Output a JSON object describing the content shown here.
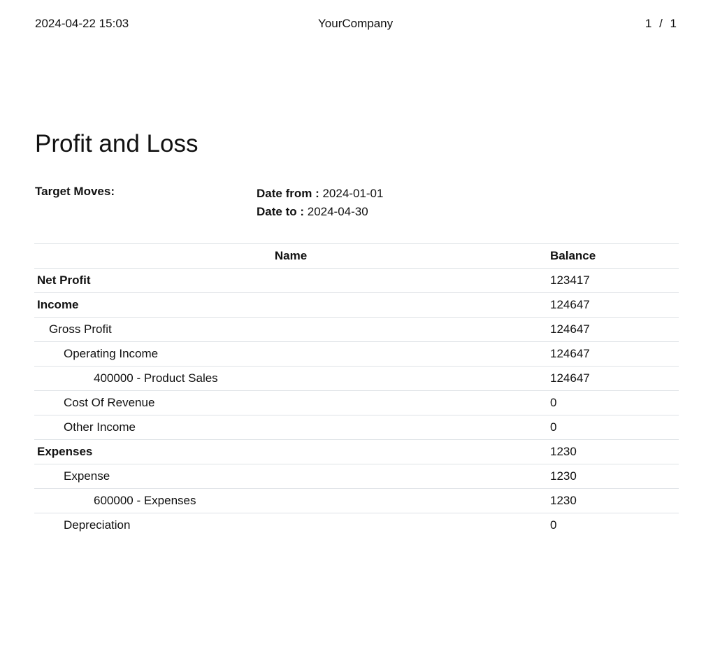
{
  "header": {
    "timestamp": "2024-04-22 15:03",
    "company": "YourCompany",
    "page_indicator": "1 / 1"
  },
  "report": {
    "title": "Profit and Loss",
    "target_moves_label": "Target Moves:",
    "date_from_label": "Date from :",
    "date_from_value": "2024-01-01",
    "date_to_label": "Date to :",
    "date_to_value": "2024-04-30"
  },
  "table": {
    "columns": [
      "Name",
      "Balance"
    ],
    "rows": [
      {
        "name": "Net Profit",
        "balance": "123417",
        "level": 1
      },
      {
        "name": "Income",
        "balance": "124647",
        "level": 1
      },
      {
        "name": "Gross Profit",
        "balance": "124647",
        "level": 2
      },
      {
        "name": "Operating Income",
        "balance": "124647",
        "level": 3
      },
      {
        "name": "400000 - Product Sales",
        "balance": "124647",
        "level": 4
      },
      {
        "name": "Cost Of Revenue",
        "balance": "0",
        "level": 3
      },
      {
        "name": "Other Income",
        "balance": "0",
        "level": 3
      },
      {
        "name": "Expenses",
        "balance": "1230",
        "level": 1
      },
      {
        "name": "Expense",
        "balance": "1230",
        "level": 3
      },
      {
        "name": "600000 - Expenses",
        "balance": "1230",
        "level": 4
      },
      {
        "name": "Depreciation",
        "balance": "0",
        "level": 3
      }
    ]
  }
}
